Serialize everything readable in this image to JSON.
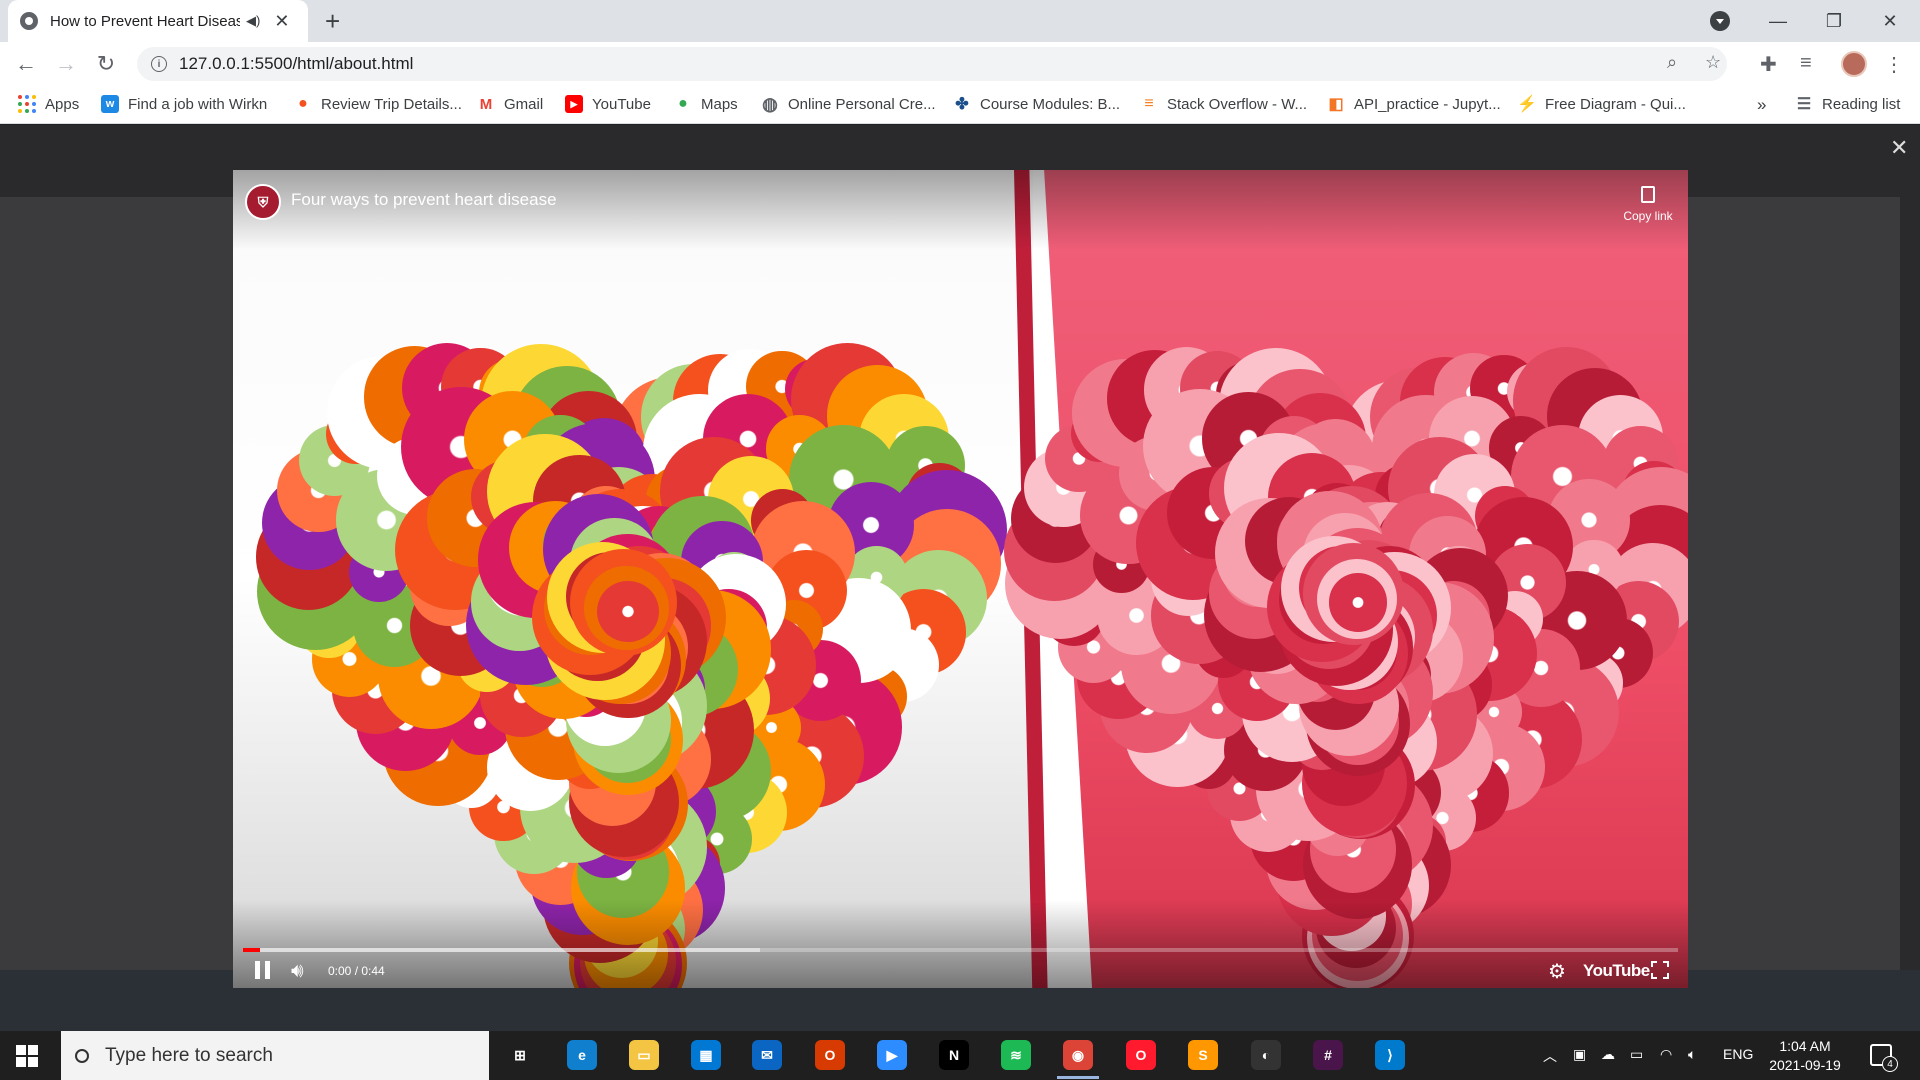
{
  "browser": {
    "tab": {
      "title": "How to Prevent Heart Disease",
      "audio_icon": "speaker-icon",
      "close": "✕"
    },
    "new_tab": "+",
    "window_controls": {
      "minimize": "—",
      "restore": "❐",
      "close": "✕"
    },
    "url": "127.0.0.1:5500/html/about.html",
    "bookmarks": [
      {
        "label": "Apps",
        "icon": "apps-grid-icon",
        "color": "#4285f4"
      },
      {
        "label": "Find a job with Wirkn",
        "icon": "wirkn-icon",
        "color": "#1e88e5",
        "glyph": "w"
      },
      {
        "label": "Review Trip Details...",
        "icon": "map-pin-icon",
        "color": "#f4511e",
        "glyph": "●"
      },
      {
        "label": "Gmail",
        "icon": "gmail-icon",
        "color": "#ea4335",
        "glyph": "M"
      },
      {
        "label": "YouTube",
        "icon": "youtube-icon",
        "color": "#ff0000",
        "glyph": "▶"
      },
      {
        "label": "Maps",
        "icon": "maps-icon",
        "color": "#34a853",
        "glyph": "●"
      },
      {
        "label": "Online Personal Cre...",
        "icon": "globe-icon",
        "color": "#5f6368",
        "glyph": "◍"
      },
      {
        "label": "Course Modules: B...",
        "icon": "course-icon",
        "color": "#1a4f8b",
        "glyph": "✤"
      },
      {
        "label": "Stack Overflow - W...",
        "icon": "stackoverflow-icon",
        "color": "#f48024",
        "glyph": "≡"
      },
      {
        "label": "API_practice - Jupyt...",
        "icon": "jupyter-icon",
        "color": "#f37626",
        "glyph": "◧"
      },
      {
        "label": "Free Diagram - Qui...",
        "icon": "diagram-icon",
        "color": "#4a90e2",
        "glyph": "⚡"
      }
    ],
    "more_bookmarks": "»",
    "reading_list": "Reading list"
  },
  "video": {
    "title": "Four ways to prevent heart disease",
    "copy_link": "Copy link",
    "time": "0:00 / 0:44",
    "brand": "YouTube",
    "progress_played": 0.012,
    "progress_buffered": 0.36
  },
  "taskbar": {
    "search_placeholder": "Type here to search",
    "apps": [
      {
        "name": "task-view-icon",
        "color": "transparent",
        "glyph": "⊞"
      },
      {
        "name": "edge-icon",
        "color": "#0f7fce",
        "glyph": "e"
      },
      {
        "name": "file-explorer-icon",
        "color": "#f4c542",
        "glyph": "▭"
      },
      {
        "name": "store-icon",
        "color": "#0078d4",
        "glyph": "▦"
      },
      {
        "name": "mail-icon",
        "color": "#0a66c2",
        "glyph": "✉"
      },
      {
        "name": "office-icon",
        "color": "#d83b01",
        "glyph": "O"
      },
      {
        "name": "zoom-icon",
        "color": "#2d8cff",
        "glyph": "▶"
      },
      {
        "name": "netflix-icon",
        "color": "#000000",
        "glyph": "N"
      },
      {
        "name": "spotify-icon",
        "color": "#1db954",
        "glyph": "≋"
      },
      {
        "name": "chrome-icon",
        "color": "#db4437",
        "glyph": "◉"
      },
      {
        "name": "opera-icon",
        "color": "#ff1b2d",
        "glyph": "O"
      },
      {
        "name": "sublime-icon",
        "color": "#ff9800",
        "glyph": "S"
      },
      {
        "name": "alienware-icon",
        "color": "#333333",
        "glyph": "◐"
      },
      {
        "name": "slack-icon",
        "color": "#4a154b",
        "glyph": "#"
      },
      {
        "name": "vscode-icon",
        "color": "#007acc",
        "glyph": "⟩"
      }
    ],
    "language": "ENG",
    "time": "1:04 AM",
    "date": "2021-09-19",
    "notification_count": "4"
  }
}
